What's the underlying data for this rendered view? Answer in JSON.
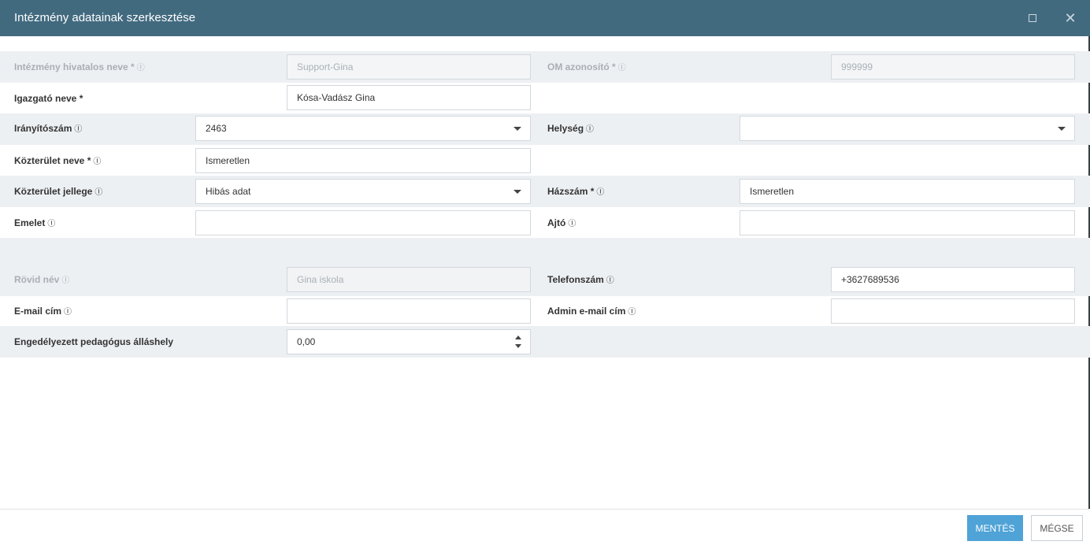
{
  "dialog": {
    "title": "Intézmény adatainak szerkesztése"
  },
  "info_glyph": "Ⓘ",
  "fields": {
    "official_name": {
      "label": "Intézmény hivatalos neve *",
      "value": "Support-Gina"
    },
    "om_id": {
      "label": "OM azonosító *",
      "value": "999999"
    },
    "director": {
      "label": "Igazgató neve *",
      "value": "Kósa-Vadász Gina"
    },
    "postal_code": {
      "label": "Irányítószám",
      "value": "2463"
    },
    "city": {
      "label": "Helység",
      "value": ""
    },
    "street_name": {
      "label": "Közterület neve *",
      "value": "Ismeretlen"
    },
    "street_type": {
      "label": "Közterület jellege",
      "value": "Hibás adat"
    },
    "house_number": {
      "label": "Házszám *",
      "value": "Ismeretlen"
    },
    "floor": {
      "label": "Emelet",
      "value": ""
    },
    "door": {
      "label": "Ajtó",
      "value": ""
    },
    "short_name": {
      "label": "Rövid név",
      "value": "Gina iskola"
    },
    "phone": {
      "label": "Telefonszám",
      "value": "+3627689536"
    },
    "email": {
      "label": "E-mail cím",
      "value": ""
    },
    "admin_email": {
      "label": "Admin e-mail cím",
      "value": ""
    },
    "teacher_positions": {
      "label": "Engedélyezett pedagógus álláshely",
      "value": "0,00"
    }
  },
  "footer": {
    "save_label": "MENTÉS",
    "cancel_label": "MÉGSE"
  },
  "colors": {
    "titlebar": "#426a7f",
    "primary_button": "#4fa3d7",
    "row_shade": "#edf0f3"
  },
  "icons": {
    "maximize": "maximize-icon",
    "close": "close-icon",
    "info": "info-icon",
    "dropdown": "chevron-down-icon",
    "spinner": "spinner-icon"
  }
}
